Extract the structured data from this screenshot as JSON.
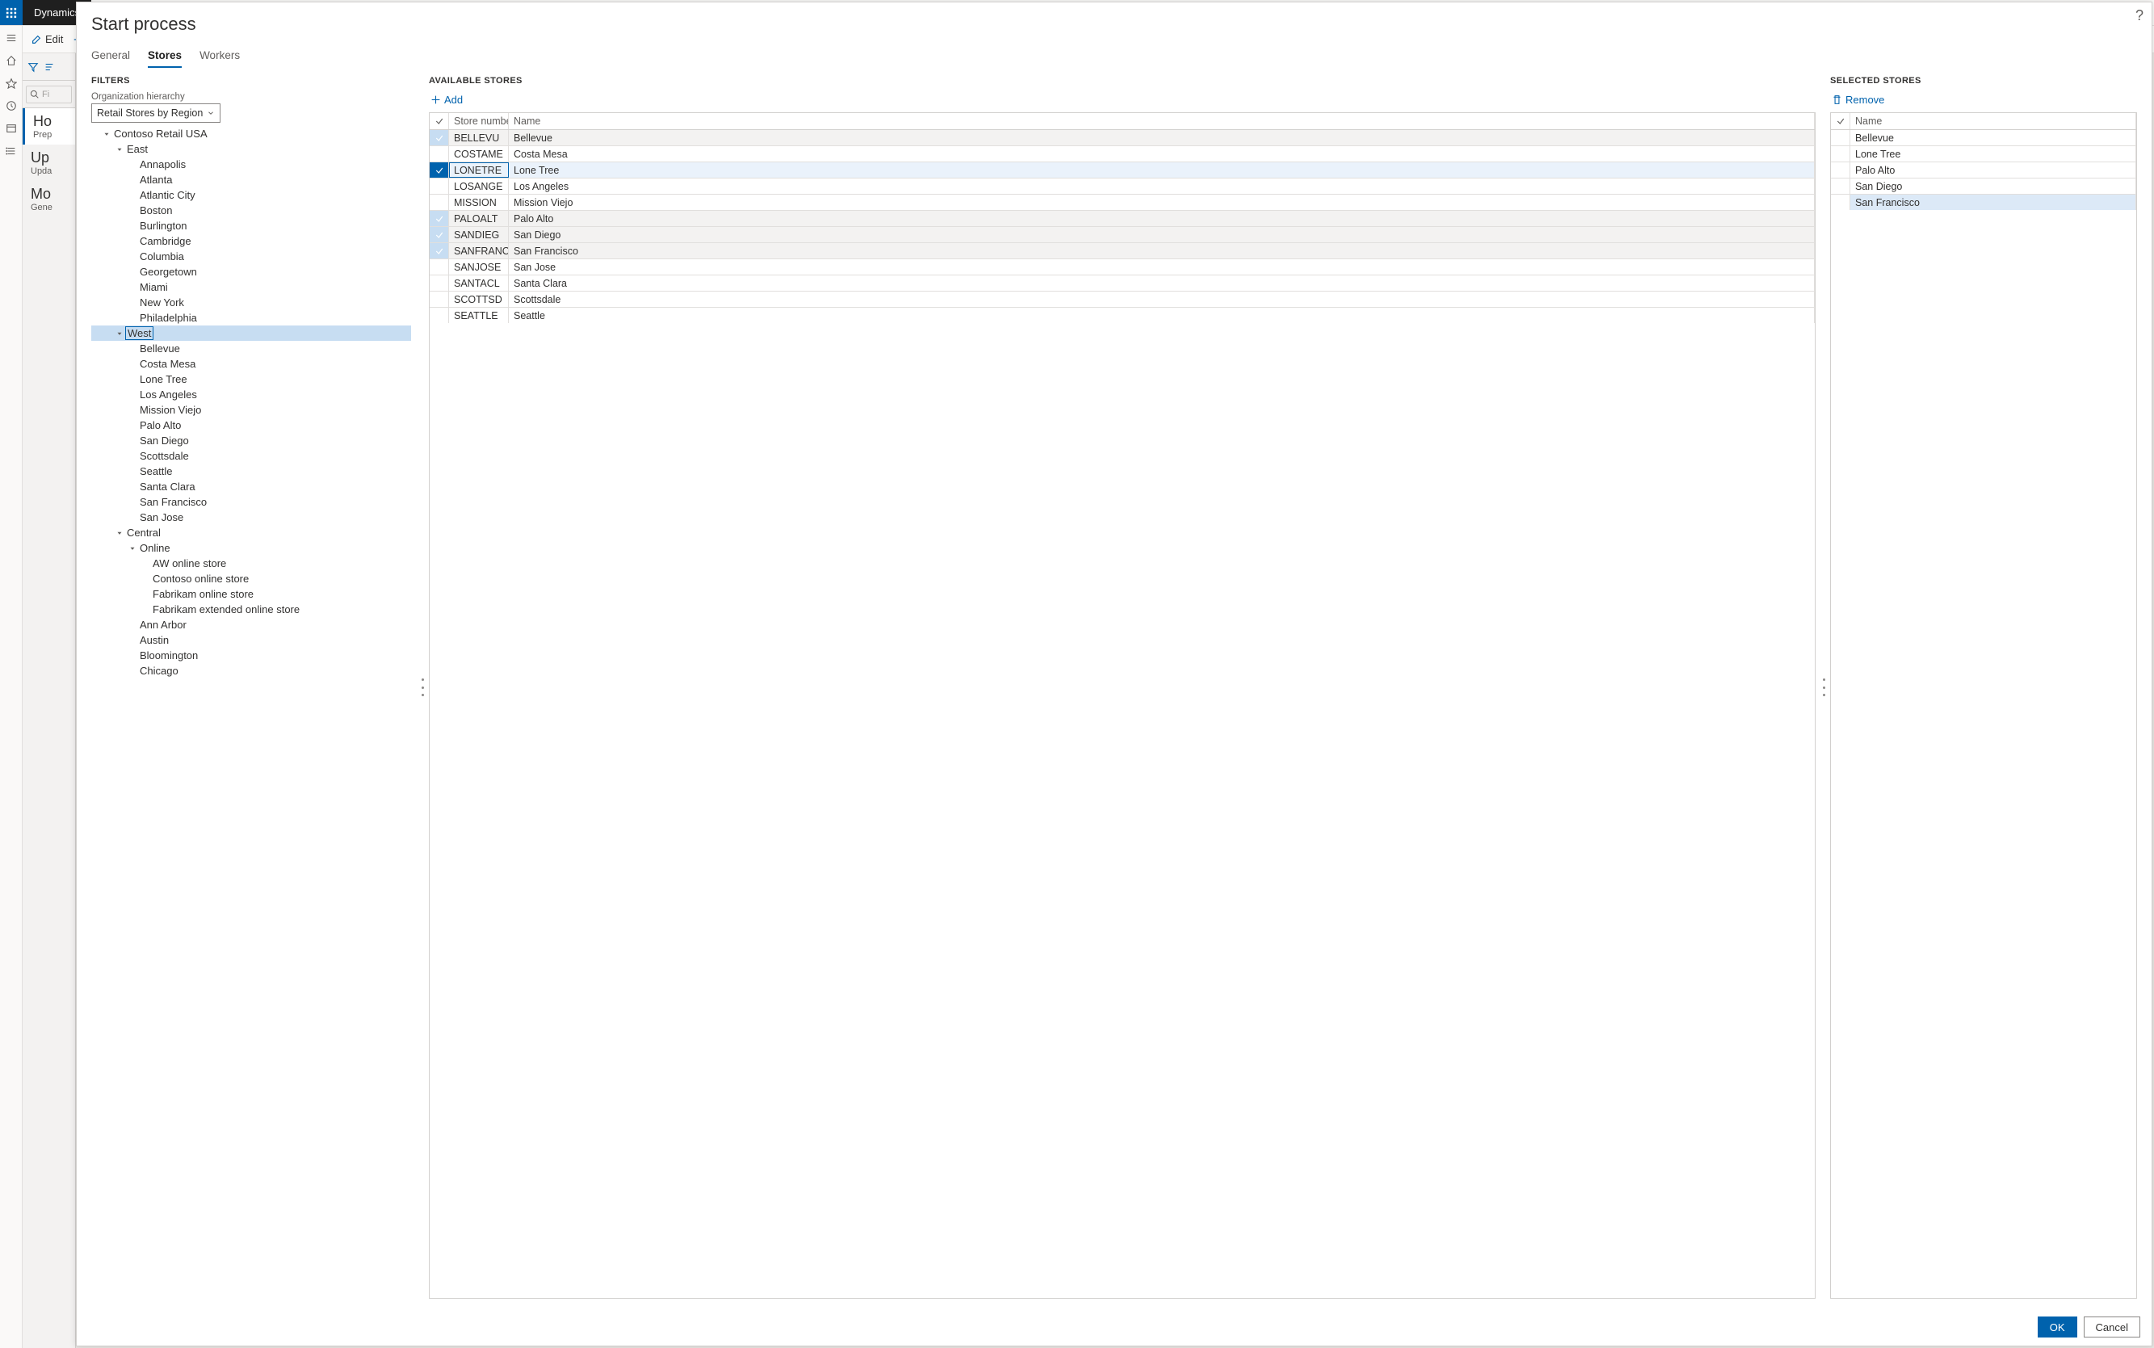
{
  "app": {
    "title": "Dynamics",
    "action_edit": "Edit",
    "filter_placeholder": "Fi",
    "list": [
      {
        "title": "Ho",
        "sub": "Prep",
        "selected": true
      },
      {
        "title": "Up",
        "sub": "Upda",
        "selected": false
      },
      {
        "title": "Mo",
        "sub": "Gene",
        "selected": false
      }
    ]
  },
  "modal": {
    "title": "Start process",
    "tabs": {
      "general": "General",
      "stores": "Stores",
      "workers": "Workers",
      "active": "Stores"
    },
    "filters": {
      "header": "FILTERS",
      "field_label": "Organization hierarchy",
      "select_value": "Retail Stores by Region",
      "tree": {
        "root": "Contoso Retail USA",
        "east": "East",
        "east_children": [
          "Annapolis",
          "Atlanta",
          "Atlantic City",
          "Boston",
          "Burlington",
          "Cambridge",
          "Columbia",
          "Georgetown",
          "Miami",
          "New York",
          "Philadelphia"
        ],
        "west": "West",
        "west_children": [
          "Bellevue",
          "Costa Mesa",
          "Lone Tree",
          "Los Angeles",
          "Mission Viejo",
          "Palo Alto",
          "San Diego",
          "Scottsdale",
          "Seattle",
          "Santa Clara",
          "San Francisco",
          "San Jose"
        ],
        "central": "Central",
        "online": "Online",
        "online_children": [
          "AW online store",
          "Contoso online store",
          "Fabrikam online store",
          "Fabrikam extended online store"
        ],
        "central_tail": [
          "Ann Arbor",
          "Austin",
          "Bloomington",
          "Chicago"
        ]
      }
    },
    "available": {
      "header": "AVAILABLE STORES",
      "add_label": "Add",
      "col_num": "Store number",
      "col_name": "Name",
      "rows": [
        {
          "num": "BELLEVU",
          "name": "Bellevue",
          "checked": true,
          "focused": false
        },
        {
          "num": "COSTAME",
          "name": "Costa Mesa",
          "checked": false,
          "focused": false
        },
        {
          "num": "LONETRE",
          "name": "Lone Tree",
          "checked": true,
          "focused": true
        },
        {
          "num": "LOSANGE",
          "name": "Los Angeles",
          "checked": false,
          "focused": false
        },
        {
          "num": "MISSION",
          "name": "Mission Viejo",
          "checked": false,
          "focused": false
        },
        {
          "num": "PALOALT",
          "name": "Palo Alto",
          "checked": true,
          "focused": false
        },
        {
          "num": "SANDIEG",
          "name": "San Diego",
          "checked": true,
          "focused": false
        },
        {
          "num": "SANFRANCIS",
          "name": "San Francisco",
          "checked": true,
          "focused": false
        },
        {
          "num": "SANJOSE",
          "name": "San Jose",
          "checked": false,
          "focused": false
        },
        {
          "num": "SANTACL",
          "name": "Santa Clara",
          "checked": false,
          "focused": false
        },
        {
          "num": "SCOTTSD",
          "name": "Scottsdale",
          "checked": false,
          "focused": false
        },
        {
          "num": "SEATTLE",
          "name": "Seattle",
          "checked": false,
          "focused": false
        }
      ]
    },
    "selected": {
      "header": "SELECTED STORES",
      "remove_label": "Remove",
      "col_name": "Name",
      "rows": [
        {
          "name": "Bellevue",
          "focused": false
        },
        {
          "name": "Lone Tree",
          "focused": false
        },
        {
          "name": "Palo Alto",
          "focused": false
        },
        {
          "name": "San Diego",
          "focused": false
        },
        {
          "name": "San Francisco",
          "focused": true
        }
      ]
    },
    "footer": {
      "ok": "OK",
      "cancel": "Cancel"
    }
  }
}
